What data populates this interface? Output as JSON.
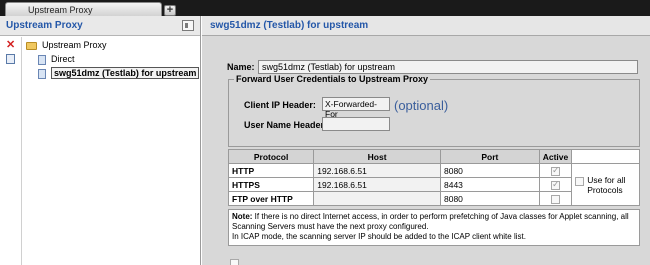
{
  "tabs": [
    {
      "label": "Upstream Proxy"
    }
  ],
  "tab_add_label": "+",
  "left_panel": {
    "title": "Upstream Proxy",
    "tree": [
      {
        "label": "Upstream Proxy",
        "type": "folder"
      },
      {
        "label": "Direct",
        "type": "doc"
      },
      {
        "label": "swg51dmz (Testlab) for upstream",
        "type": "doc",
        "selected": true
      }
    ]
  },
  "right_panel": {
    "title": "swg51dmz (Testlab) for upstream",
    "name_label": "Name:",
    "name_value": "swg51dmz (Testlab) for upstream",
    "forward_group": {
      "legend": "Forward User Credentials to Upstream Proxy",
      "client_ip_label": "Client IP Header:",
      "client_ip_value": "X-Forwarded-For",
      "user_name_label": "User Name Header:",
      "user_name_value": "",
      "optional_text": "(optional)"
    },
    "protocol_table": {
      "headers": [
        "Protocol",
        "Host",
        "Port",
        "Active"
      ],
      "rows": [
        {
          "protocol": "HTTP",
          "host": "192.168.6.51",
          "port": "8080",
          "active": true
        },
        {
          "protocol": "HTTPS",
          "host": "192.168.6.51",
          "port": "8443",
          "active": true
        },
        {
          "protocol": "FTP over HTTP",
          "host": "",
          "port": "8080",
          "active": false
        }
      ],
      "use_all_label": "Use for all Protocols"
    },
    "note": {
      "prefix": "Note:",
      "line1": " If there is no direct Internet access, in order to perform prefetching of Java classes for Applet scanning, all Scanning Servers must have the next proxy configured.",
      "line2": "In ICAP mode, the scanning server IP should be added to the ICAP client white list."
    }
  },
  "colors": {
    "header_text": "#2457a8",
    "panel_bg": "#d8d8d8",
    "optional_text": "#3a5e9c"
  }
}
